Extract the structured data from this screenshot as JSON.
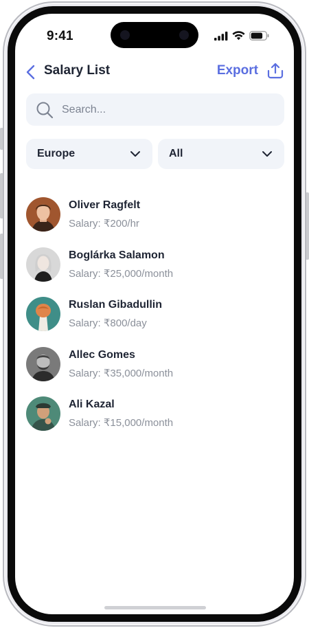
{
  "status_bar": {
    "time": "9:41"
  },
  "header": {
    "title": "Salary List",
    "export_label": "Export"
  },
  "search": {
    "placeholder": "Search...",
    "value": ""
  },
  "filters": {
    "region": "Europe",
    "category": "All"
  },
  "employees": [
    {
      "name": "Oliver Ragfelt",
      "salary": "Salary: ₹200/hr"
    },
    {
      "name": "Boglárka Salamon",
      "salary": "Salary: ₹25,000/month"
    },
    {
      "name": "Ruslan Gibadullin",
      "salary": "Salary: ₹800/day"
    },
    {
      "name": "Allec Gomes",
      "salary": "Salary: ₹35,000/month"
    },
    {
      "name": "Ali Kazal",
      "salary": "Salary: ₹15,000/month"
    }
  ],
  "colors": {
    "accent": "#5a6ee0",
    "text": "#1e2433",
    "muted": "#8b909a",
    "field_bg": "#f1f4f9"
  },
  "icons": {
    "back": "chevron-left-icon",
    "export": "share-icon",
    "search": "search-icon",
    "dropdown": "chevron-down-icon",
    "signal": "signal-icon",
    "wifi": "wifi-icon",
    "battery": "battery-icon"
  }
}
